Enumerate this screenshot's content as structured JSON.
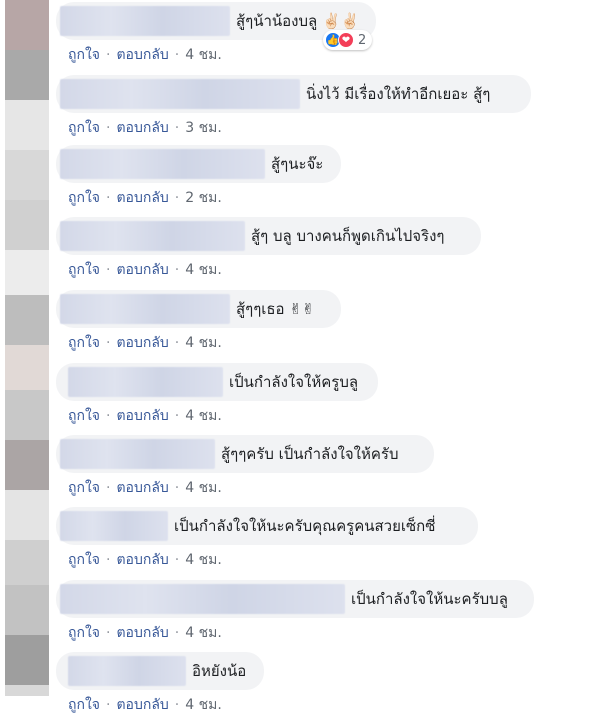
{
  "colors": {
    "bubble_bg": "#f2f3f5",
    "link": "#385898",
    "meta_text": "#606770",
    "like_blue": "#1877f2",
    "love_red": "#f33e58"
  },
  "actions": {
    "like_label": "ถูกใจ",
    "reply_label": "ตอบกลับ",
    "separator": "·"
  },
  "comments": [
    {
      "text": "สู้ๆน้าน้องบลู ✌🏻✌🏻",
      "time": "4 ชม.",
      "reactions": {
        "icons": [
          "like-icon",
          "love-icon"
        ],
        "count": "2"
      }
    },
    {
      "text": "นิ่งไว้ มีเรื่องให้ทำอีกเยอะ สู้ๆ",
      "time": "3 ชม."
    },
    {
      "text": "สู้ๆนะจ๊ะ",
      "time": "2 ชม."
    },
    {
      "text": "สู้ๆ บลู บางคนก็พูดเกินไปจริงๆ",
      "time": "4 ชม."
    },
    {
      "text": "สู้ๆๆเธอ ✌✌",
      "time": "4 ชม."
    },
    {
      "text": "เป็นกำลังใจให้ครูบลู",
      "time": "4 ชม."
    },
    {
      "text": "สู้ๆๆครับ เป็นกำลังใจให้ครับ",
      "time": "4 ชม."
    },
    {
      "text": "เป็นกำลังใจให้นะครับคุณครูคนสวยเซ็กซี่",
      "time": "4 ชม."
    },
    {
      "text": "เป็นกำลังใจให้นะครับบลู",
      "time": "4 ชม."
    },
    {
      "text": "อิหยังน้อ",
      "time": "4 ชม."
    }
  ]
}
